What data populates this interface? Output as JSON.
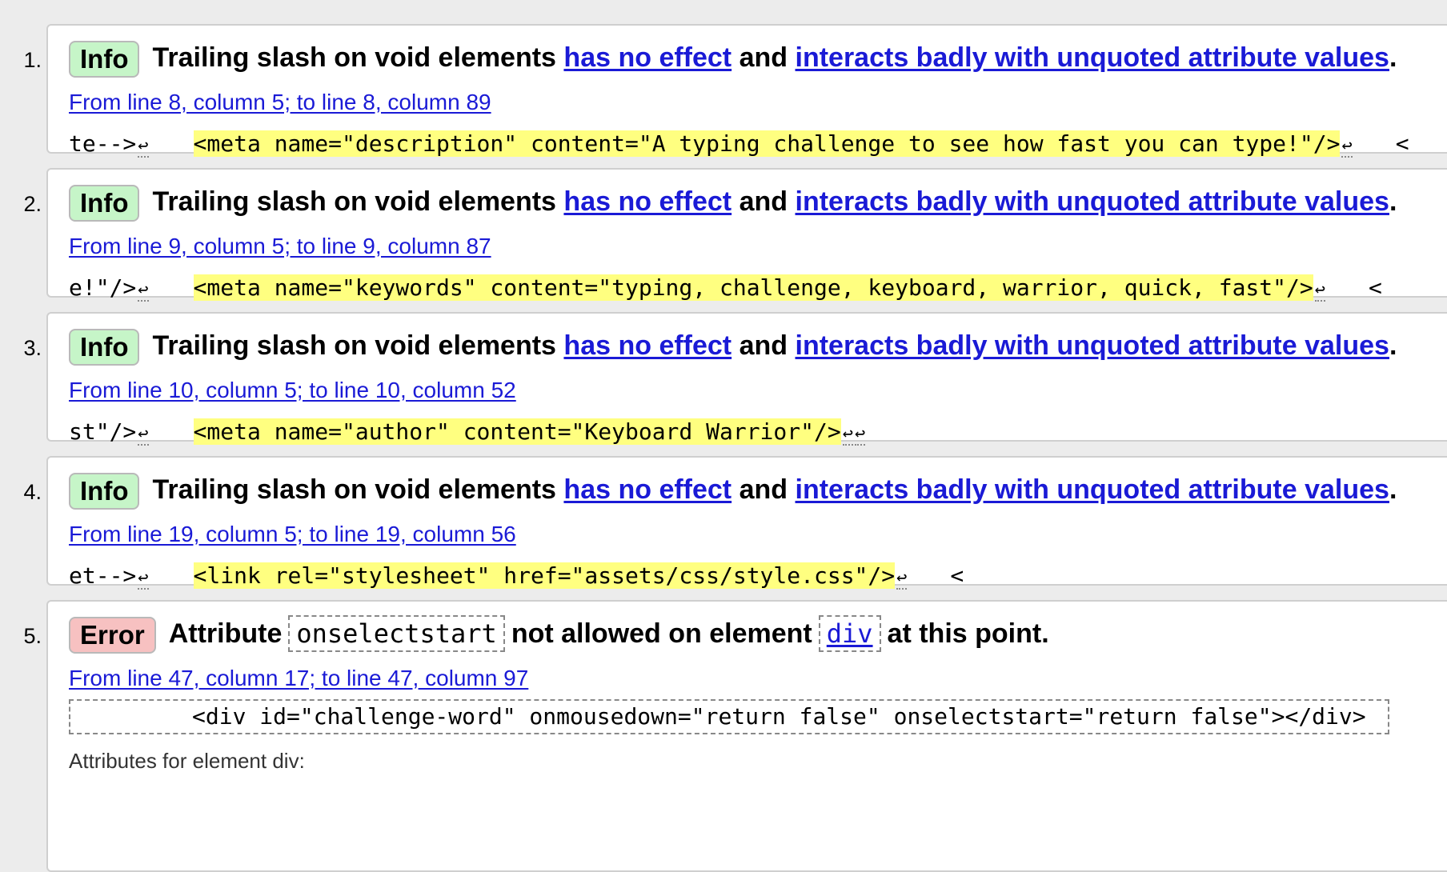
{
  "messages": [
    {
      "num": "1.",
      "badge": "Info",
      "title_pre": "Trailing slash on void elements",
      "link1": "has no effect",
      "mid": "and",
      "link2": "interacts badly with unquoted attribute values",
      "end": ".",
      "location": "From line 8, column 5; to line 8, column 89",
      "code_pre": "te-->",
      "code_hl": "<meta name=\"description\" content=\"A typing challenge to see how fast you can type!\"/>",
      "code_post": "<"
    },
    {
      "num": "2.",
      "badge": "Info",
      "title_pre": "Trailing slash on void elements",
      "link1": "has no effect",
      "mid": "and",
      "link2": "interacts badly with unquoted attribute values",
      "end": ".",
      "location": "From line 9, column 5; to line 9, column 87",
      "code_pre": "e!\"/>",
      "code_hl": "<meta name=\"keywords\" content=\"typing, challenge, keyboard, warrior, quick, fast\"/>",
      "code_post": "<"
    },
    {
      "num": "3.",
      "badge": "Info",
      "title_pre": "Trailing slash on void elements",
      "link1": "has no effect",
      "mid": "and",
      "link2": "interacts badly with unquoted attribute values",
      "end": ".",
      "location": "From line 10, column 5; to line 10, column 52",
      "code_pre": "st\"/>",
      "code_hl": "<meta name=\"author\" content=\"Keyboard Warrior\"/>",
      "code_post": ""
    },
    {
      "num": "4.",
      "badge": "Info",
      "title_pre": "Trailing slash on void elements",
      "link1": "has no effect",
      "mid": "and",
      "link2": "interacts badly with unquoted attribute values",
      "end": ".",
      "location": "From line 19, column 5; to line 19, column 56",
      "code_pre": "et-->",
      "code_hl": "<link rel=\"stylesheet\" href=\"assets/css/style.css\"/>",
      "code_post": "<"
    }
  ],
  "error": {
    "num": "5.",
    "badge": "Error",
    "attr_word": "Attribute",
    "attr_name": "onselectstart",
    "mid": "not allowed on element",
    "element": "div",
    "end": "at this point.",
    "location": "From line 47, column 17; to line 47, column 97",
    "code_hl": "<div id=\"challenge-word\" onmousedown=\"return false\" ",
    "code_hl2": "onselectstart=\"return false\"",
    "code_post": "></div>",
    "trunc": "Attributes for element div:"
  },
  "glyphs": {
    "return": "↩"
  },
  "colors": {
    "info_badge": "#c6f5c8",
    "error_badge": "#f7c1c1",
    "highlight": "#ffff80",
    "highlight_attr": "#c9e7a3",
    "link": "#1a1ad6"
  }
}
